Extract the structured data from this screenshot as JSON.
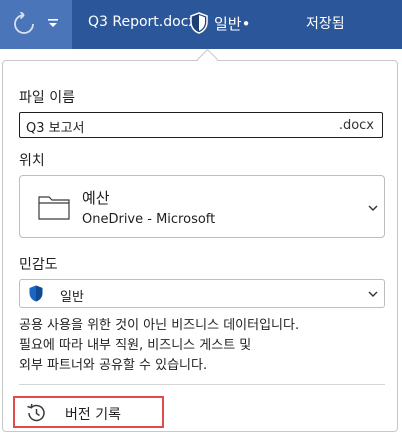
{
  "titlebar": {
    "filename": "Q3 Report.docx",
    "sensitivity_label": "일반•",
    "save_status": "저장됨",
    "icons": [
      "undo-icon",
      "quick-access-dropdown-icon",
      "shield-icon"
    ],
    "colors": {
      "bar": "#2b579a",
      "bar_left": "#4a75b8",
      "text": "#ffffff"
    }
  },
  "file_panel": {
    "name_label": "파일 이름",
    "name_value": "Q3 보고서",
    "extension": ".docx",
    "location_label": "위치",
    "location": {
      "name": "예산",
      "path": "OneDrive - Microsoft",
      "icon": "folder-icon"
    },
    "sensitivity_label": "민감도",
    "sensitivity_value": "일반",
    "description_lines": [
      "공용 사용을 위한 것이 아닌 비즈니스 데이터입니다.",
      "필요에 따라 내부 직원, 비즈니스 게스트 및",
      "외부 파트너와 공유할 수 있습니다."
    ],
    "version_history_label": "버전 기록",
    "colors": {
      "shield": "#1a66c2",
      "highlight": "#e24b4b"
    }
  }
}
